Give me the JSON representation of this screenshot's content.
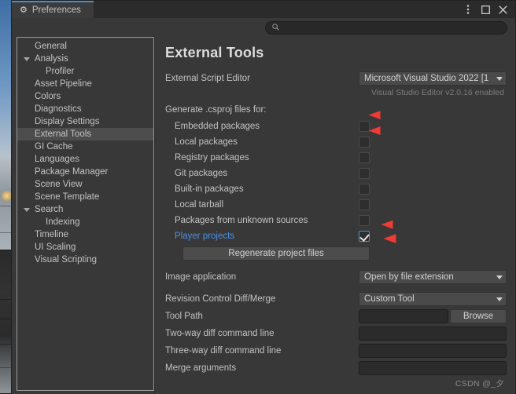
{
  "window": {
    "tab_label": "Preferences",
    "tab_icon": "gear-icon",
    "controls": {
      "menu": "more-vertical-icon",
      "maximize": "maximize-icon",
      "close": "close-icon"
    }
  },
  "search": {
    "icon": "search-icon",
    "value": "",
    "placeholder": ""
  },
  "sidebar": {
    "items": [
      {
        "label": "General",
        "level": 0,
        "expandable": false,
        "selected": false
      },
      {
        "label": "Analysis",
        "level": 0,
        "expandable": true,
        "selected": false
      },
      {
        "label": "Profiler",
        "level": 1,
        "expandable": false,
        "selected": false
      },
      {
        "label": "Asset Pipeline",
        "level": 0,
        "expandable": false,
        "selected": false
      },
      {
        "label": "Colors",
        "level": 0,
        "expandable": false,
        "selected": false
      },
      {
        "label": "Diagnostics",
        "level": 0,
        "expandable": false,
        "selected": false
      },
      {
        "label": "Display Settings",
        "level": 0,
        "expandable": false,
        "selected": false
      },
      {
        "label": "External Tools",
        "level": 0,
        "expandable": false,
        "selected": true
      },
      {
        "label": "GI Cache",
        "level": 0,
        "expandable": false,
        "selected": false
      },
      {
        "label": "Languages",
        "level": 0,
        "expandable": false,
        "selected": false
      },
      {
        "label": "Package Manager",
        "level": 0,
        "expandable": false,
        "selected": false
      },
      {
        "label": "Scene View",
        "level": 0,
        "expandable": false,
        "selected": false
      },
      {
        "label": "Scene Template",
        "level": 0,
        "expandable": false,
        "selected": false
      },
      {
        "label": "Search",
        "level": 0,
        "expandable": true,
        "selected": false
      },
      {
        "label": "Indexing",
        "level": 1,
        "expandable": false,
        "selected": false
      },
      {
        "label": "Timeline",
        "level": 0,
        "expandable": false,
        "selected": false
      },
      {
        "label": "UI Scaling",
        "level": 0,
        "expandable": false,
        "selected": false
      },
      {
        "label": "Visual Scripting",
        "level": 0,
        "expandable": false,
        "selected": false
      }
    ]
  },
  "main": {
    "title": "External Tools",
    "script_editor": {
      "label": "External Script Editor",
      "value": "Microsoft Visual Studio 2022 [1",
      "hint": "Visual Studio Editor v2.0.16 enabled"
    },
    "csproj": {
      "section_label": "Generate .csproj files for:",
      "options": [
        {
          "label": "Embedded packages",
          "checked": false,
          "highlighted": false
        },
        {
          "label": "Local packages",
          "checked": false,
          "highlighted": false
        },
        {
          "label": "Registry packages",
          "checked": false,
          "highlighted": false
        },
        {
          "label": "Git packages",
          "checked": false,
          "highlighted": false
        },
        {
          "label": "Built-in packages",
          "checked": false,
          "highlighted": false
        },
        {
          "label": "Local tarball",
          "checked": false,
          "highlighted": false
        },
        {
          "label": "Packages from unknown sources",
          "checked": false,
          "highlighted": false
        },
        {
          "label": "Player projects",
          "checked": true,
          "highlighted": true
        }
      ],
      "regenerate_button": "Regenerate project files"
    },
    "image_application": {
      "label": "Image application",
      "value": "Open by file extension"
    },
    "revision_control": {
      "label": "Revision Control Diff/Merge",
      "value": "Custom Tool"
    },
    "tool_path": {
      "label": "Tool Path",
      "value": "",
      "browse_button": "Browse"
    },
    "two_way_diff": {
      "label": "Two-way diff command line",
      "value": ""
    },
    "three_way_diff": {
      "label": "Three-way diff command line",
      "value": ""
    },
    "merge_arguments": {
      "label": "Merge arguments",
      "value": ""
    }
  },
  "annotations": {
    "arrow_color": "#e8312a",
    "arrows": [
      {
        "name": "arrow-embedded-packages"
      },
      {
        "name": "arrow-local-packages"
      },
      {
        "name": "arrow-player-projects"
      },
      {
        "name": "arrow-regenerate-button"
      }
    ]
  },
  "watermark": {
    "text": "CSDN @_夕"
  },
  "colors": {
    "accent_blue": "#4a90e2",
    "window_bg": "#383838",
    "panel_bg": "#2b2b2b",
    "text": "#c3c3c3"
  }
}
